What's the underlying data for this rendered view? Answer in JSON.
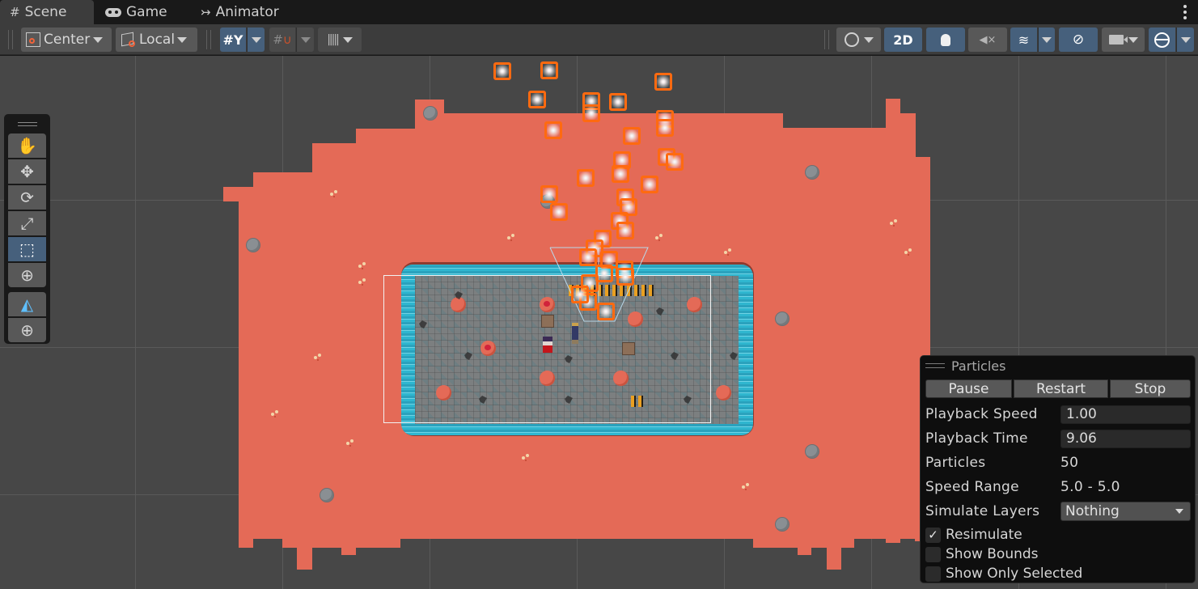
{
  "tabs": [
    {
      "label": "Scene",
      "icon": "grid-hash-icon",
      "glyph": "#",
      "active": true
    },
    {
      "label": "Game",
      "icon": "gamepad-icon",
      "glyph": "🎮",
      "active": false
    },
    {
      "label": "Animator",
      "icon": "animator-icon",
      "glyph": "↣",
      "active": false
    }
  ],
  "toolbar": {
    "pivot_mode": "Center",
    "pivot_rotation": "Local",
    "two_d_label": "2D"
  },
  "tools": [
    {
      "name": "hand-tool",
      "glyph": "✋",
      "selected": false
    },
    {
      "name": "move-tool",
      "glyph": "✥",
      "selected": false
    },
    {
      "name": "rotate-tool",
      "glyph": "⟳",
      "selected": false
    },
    {
      "name": "scale-tool",
      "glyph": "⤢",
      "selected": false
    },
    {
      "name": "rect-tool",
      "glyph": "⬚",
      "selected": true
    },
    {
      "name": "transform-tool",
      "glyph": "⊕",
      "selected": false
    },
    {
      "name": "particle-shape-tool",
      "glyph": "◭",
      "selected": false
    },
    {
      "name": "custom-transform-tool",
      "glyph": "⊕",
      "selected": false
    }
  ],
  "particles_panel": {
    "title": "Particles",
    "buttons": [
      "Pause",
      "Restart",
      "Stop"
    ],
    "playback_speed_label": "Playback Speed",
    "playback_speed": "1.00",
    "playback_time_label": "Playback Time",
    "playback_time": "9.06",
    "particles_label": "Particles",
    "particles": "50",
    "speed_range_label": "Speed Range",
    "speed_range": "5.0 - 5.0",
    "simulate_layers_label": "Simulate Layers",
    "simulate_layers": "Nothing",
    "checkboxes": [
      {
        "label": "Resimulate",
        "checked": true
      },
      {
        "label": "Show Bounds",
        "checked": false
      },
      {
        "label": "Show Only Selected",
        "checked": false
      }
    ]
  },
  "colors": {
    "accent_blue": "#46607c",
    "sand": "#e46a57",
    "particle_outline": "#ff6a10",
    "viewport_bg": "#474747"
  }
}
